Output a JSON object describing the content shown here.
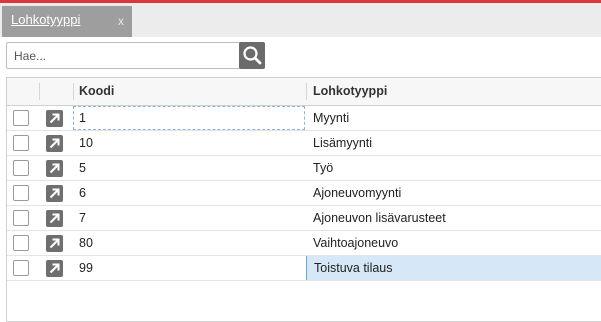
{
  "tab": {
    "label": "Lohkotyyppi",
    "close": "x"
  },
  "search": {
    "placeholder": "Hae...",
    "value": ""
  },
  "grid": {
    "columns": [
      "Koodi",
      "Lohkotyyppi"
    ],
    "rows": [
      {
        "code": "1",
        "type": "Myynti"
      },
      {
        "code": "10",
        "type": "Lisämyynti"
      },
      {
        "code": "5",
        "type": "Työ"
      },
      {
        "code": "6",
        "type": "Ajoneuvomyynti"
      },
      {
        "code": "7",
        "type": "Ajoneuvon lisävarusteet"
      },
      {
        "code": "80",
        "type": "Vaihtoajoneuvo"
      },
      {
        "code": "99",
        "type": "Toistuva tilaus"
      }
    ],
    "focused_row": 0,
    "selected_row": 6
  },
  "colors": {
    "accent": "#d9383a",
    "tab_bg": "#9e9e9e",
    "button_bg": "#6b6b6b",
    "selection": "#d6e8f7"
  },
  "icons": {
    "search": "search-icon",
    "open_row": "open-record-arrow-icon"
  }
}
